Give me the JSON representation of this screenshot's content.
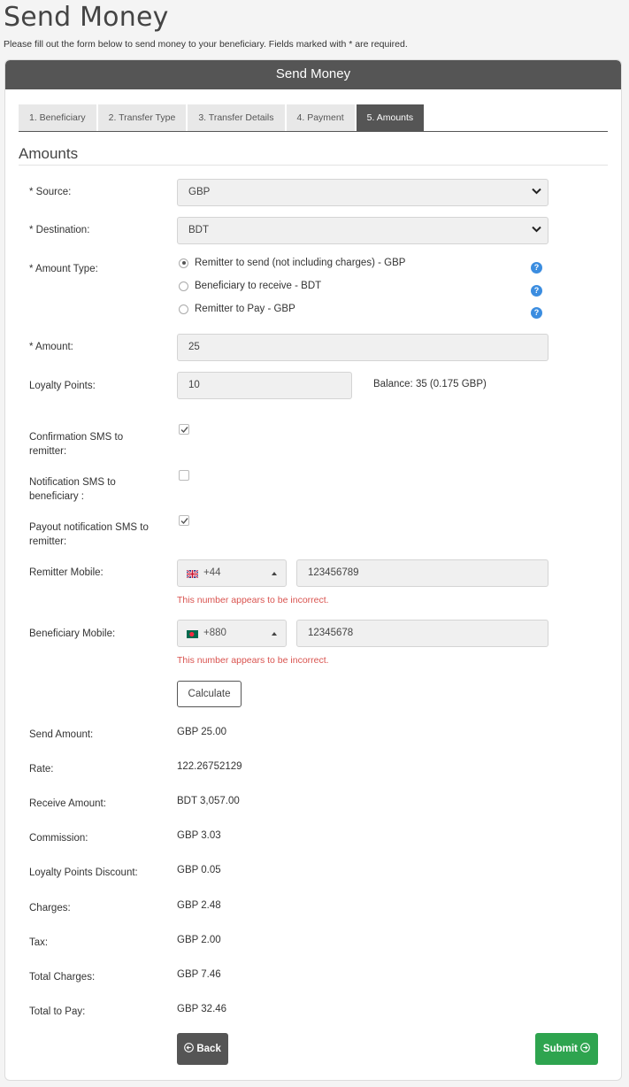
{
  "page": {
    "title": "Send Money",
    "intro": "Please fill out the form below to send money to your beneficiary. Fields marked with * are required."
  },
  "panel": {
    "header": "Send Money"
  },
  "tabs": [
    {
      "label": "1. Beneficiary",
      "active": false
    },
    {
      "label": "2. Transfer Type",
      "active": false
    },
    {
      "label": "3. Transfer Details",
      "active": false
    },
    {
      "label": "4. Payment",
      "active": false
    },
    {
      "label": "5. Amounts",
      "active": true
    }
  ],
  "section": {
    "title": "Amounts"
  },
  "form": {
    "source": {
      "label": "* Source:",
      "value": "GBP"
    },
    "destination": {
      "label": "* Destination:",
      "value": "BDT"
    },
    "amount_type": {
      "label": "* Amount Type:",
      "options": [
        {
          "label": "Remitter to send (not including charges) - GBP",
          "selected": true
        },
        {
          "label": "Beneficiary to receive - BDT",
          "selected": false
        },
        {
          "label": "Remitter to Pay - GBP",
          "selected": false
        }
      ],
      "help_icon": "question-circle-icon"
    },
    "amount": {
      "label": "* Amount:",
      "value": "25"
    },
    "loyalty": {
      "label": "Loyalty Points:",
      "value": "10",
      "balance": "Balance: 35 (0.175 GBP)"
    },
    "confirmation_sms": {
      "label": "Confirmation SMS to remitter:",
      "checked": true
    },
    "notification_sms": {
      "label": "Notification SMS to beneficiary :",
      "checked": false
    },
    "payout_sms": {
      "label": "Payout notification SMS to remitter:",
      "checked": true
    },
    "remitter_mobile": {
      "label": "Remitter Mobile:",
      "code": "+44",
      "flag": "uk-flag-icon",
      "number": "123456789",
      "error": "This number appears to be incorrect."
    },
    "beneficiary_mobile": {
      "label": "Beneficiary Mobile:",
      "code": "+880",
      "flag": "bangladesh-flag-icon",
      "number": "12345678",
      "error": "This number appears to be incorrect."
    },
    "calculate_label": "Calculate"
  },
  "summary": {
    "send_amount": {
      "label": "Send Amount:",
      "value": "GBP 25.00"
    },
    "rate": {
      "label": "Rate:",
      "value": "122.26752129"
    },
    "receive_amount": {
      "label": "Receive Amount:",
      "value": "BDT 3,057.00"
    },
    "commission": {
      "label": "Commission:",
      "value": "GBP 3.03"
    },
    "loyalty_discount": {
      "label": "Loyalty Points Discount:",
      "value": "GBP 0.05"
    },
    "charges": {
      "label": "Charges:",
      "value": "GBP 2.48"
    },
    "tax": {
      "label": "Tax:",
      "value": "GBP 2.00"
    },
    "total_charges": {
      "label": "Total Charges:",
      "value": "GBP 7.46"
    },
    "total_to_pay": {
      "label": "Total to Pay:",
      "value": "GBP 32.46"
    }
  },
  "actions": {
    "back_label": "Back",
    "submit_label": "Submit"
  },
  "colors": {
    "header": "#555555",
    "submit": "#2ea44f",
    "error": "#d9534f",
    "help": "#3b8de0"
  }
}
